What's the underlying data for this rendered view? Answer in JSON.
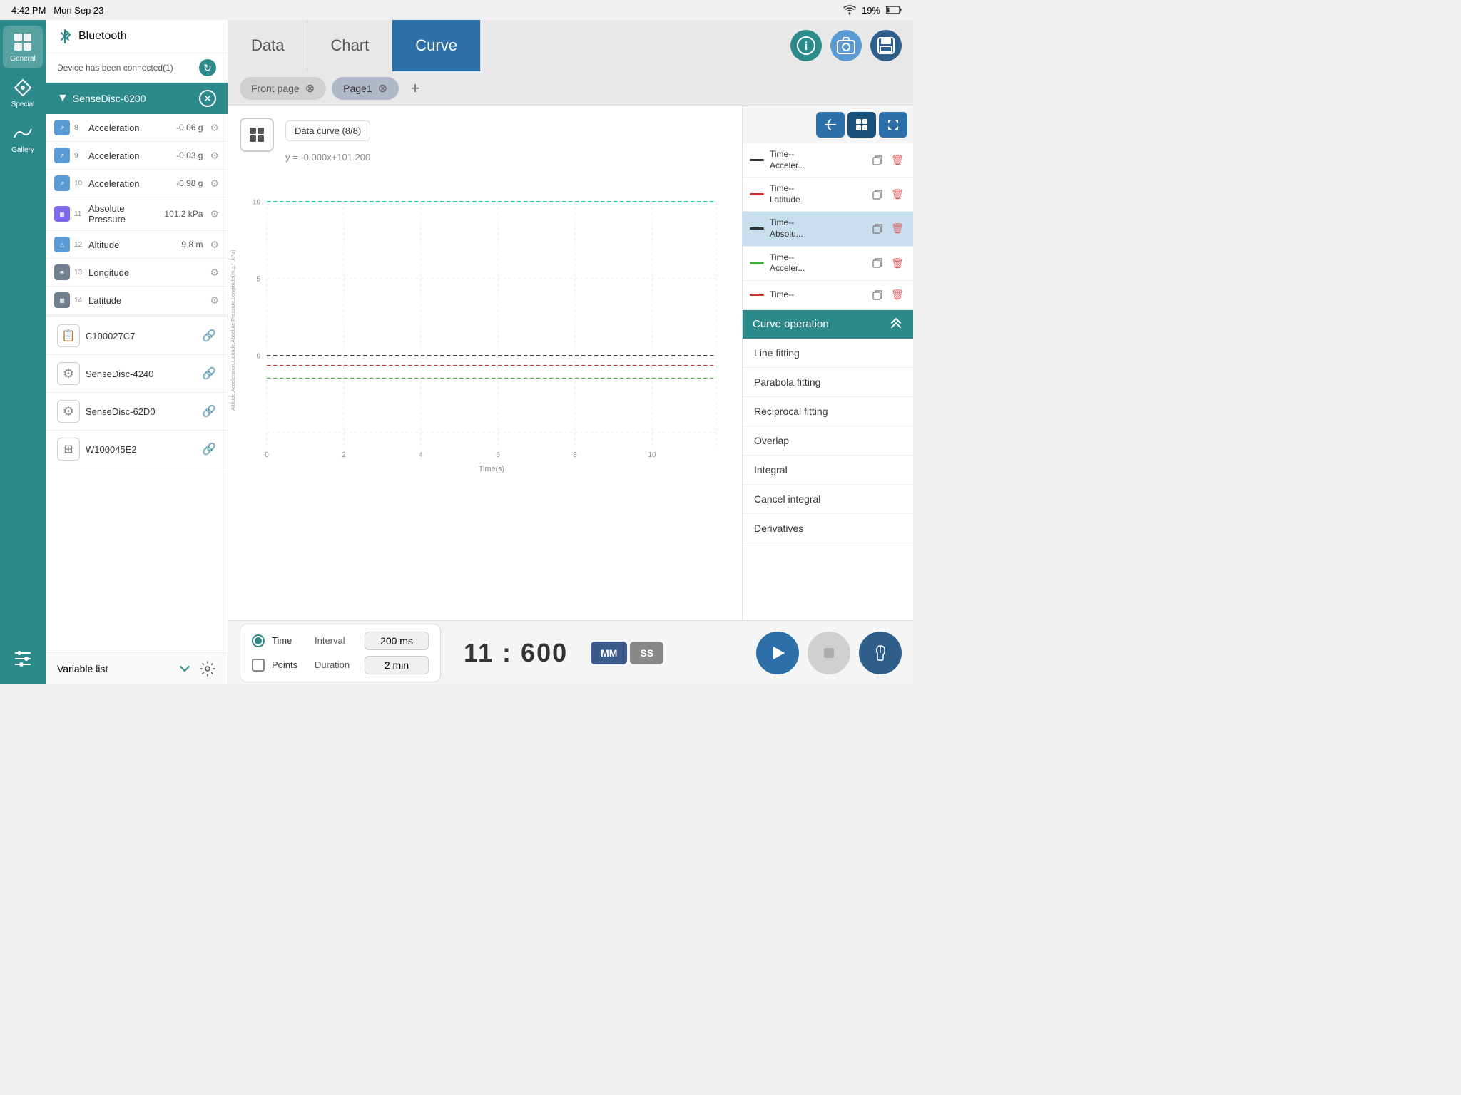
{
  "statusBar": {
    "time": "4:42 PM",
    "date": "Mon Sep 23",
    "wifi": "wifi",
    "battery": "19%"
  },
  "sidebar": {
    "items": [
      {
        "id": "general",
        "label": "General",
        "icon": "grid"
      },
      {
        "id": "special",
        "label": "Special",
        "icon": "diamond"
      },
      {
        "id": "gallery",
        "label": "Gallery",
        "icon": "chart"
      },
      {
        "id": "settings",
        "label": "",
        "icon": "sliders"
      }
    ]
  },
  "devicePanel": {
    "title": "Bluetooth",
    "connectedText": "Device has been connected(1)",
    "device": {
      "name": "SenseDisc-\n6200",
      "nameDisplay": "SenseDisc-6200"
    },
    "sensors": [
      {
        "num": "8",
        "type": "accel",
        "name": "Acceleration",
        "value": "-0.06 g"
      },
      {
        "num": "9",
        "type": "accel",
        "name": "Acceleration",
        "value": "-0.03 g"
      },
      {
        "num": "10",
        "type": "accel",
        "name": "Acceleration",
        "value": "-0.98 g"
      },
      {
        "num": "11",
        "type": "pressure",
        "name": "Absolute Pressure",
        "value": "101.2 kPa"
      },
      {
        "num": "12",
        "type": "altitude",
        "name": "Altitude",
        "value": "9.8 m"
      },
      {
        "num": "13",
        "type": "longitude",
        "name": "Longitude",
        "value": ""
      },
      {
        "num": "14",
        "type": "latitude",
        "name": "Latitude",
        "value": ""
      }
    ],
    "btDevices": [
      {
        "id": "C100027C7",
        "icon": "clipboard"
      },
      {
        "id": "SenseDisc-4240",
        "icon": "gear"
      },
      {
        "id": "SenseDisc-62D0",
        "icon": "gear"
      },
      {
        "id": "W100045E2",
        "icon": "grid"
      }
    ],
    "variableList": "Variable list"
  },
  "tabs": [
    {
      "id": "data",
      "label": "Data"
    },
    {
      "id": "chart",
      "label": "Chart"
    },
    {
      "id": "curve",
      "label": "Curve",
      "active": true
    }
  ],
  "pageTabs": [
    {
      "id": "front",
      "label": "Front page"
    },
    {
      "id": "page1",
      "label": "Page1",
      "active": true
    }
  ],
  "chart": {
    "dataLabel": "Data curve (8/8)",
    "equation": "y = -0.000x+101.200",
    "yAxisLabel": "Altitude,Acceleration,Latitude,Absolute Pressure,Longitude(m,g,° ,kPa)",
    "xAxisLabel": "Time(s)",
    "xTicks": [
      "0",
      "2",
      "4",
      "6",
      "8",
      "10"
    ],
    "yTicks": [
      "10",
      "5",
      "0"
    ]
  },
  "curveList": {
    "items": [
      {
        "id": "c1",
        "color": "#333333",
        "name": "Time--\nAcceler...",
        "nameDisplay": "Time--\nAcceler..."
      },
      {
        "id": "c2",
        "color": "#cc3333",
        "name": "Time--\nLatitude",
        "nameDisplay": "Time--\nLatitude"
      },
      {
        "id": "c3",
        "color": "#333333",
        "name": "Time--\nAbsolu...",
        "nameDisplay": "Time--\nAbsolu...",
        "selected": true
      },
      {
        "id": "c4",
        "color": "#44aa44",
        "name": "Time--\nAcceler...",
        "nameDisplay": "Time--\nAcceler..."
      },
      {
        "id": "c5",
        "color": "#cc3333",
        "name": "Time--",
        "nameDisplay": "Time--"
      }
    ]
  },
  "curveOperation": {
    "header": "Curve operation",
    "items": [
      "Line fitting",
      "Parabola fitting",
      "Reciprocal fitting",
      "Overlap",
      "Integral",
      "Cancel integral",
      "Derivatives"
    ]
  },
  "bottomBar": {
    "timeLabel": "Time",
    "intervalLabel": "Interval",
    "intervalValue": "200 ms",
    "pointsLabel": "Points",
    "durationLabel": "Duration",
    "durationValue": "2 min",
    "counterDisplay": "11 : 600",
    "mmLabel": "MM",
    "ssLabel": "SS"
  }
}
